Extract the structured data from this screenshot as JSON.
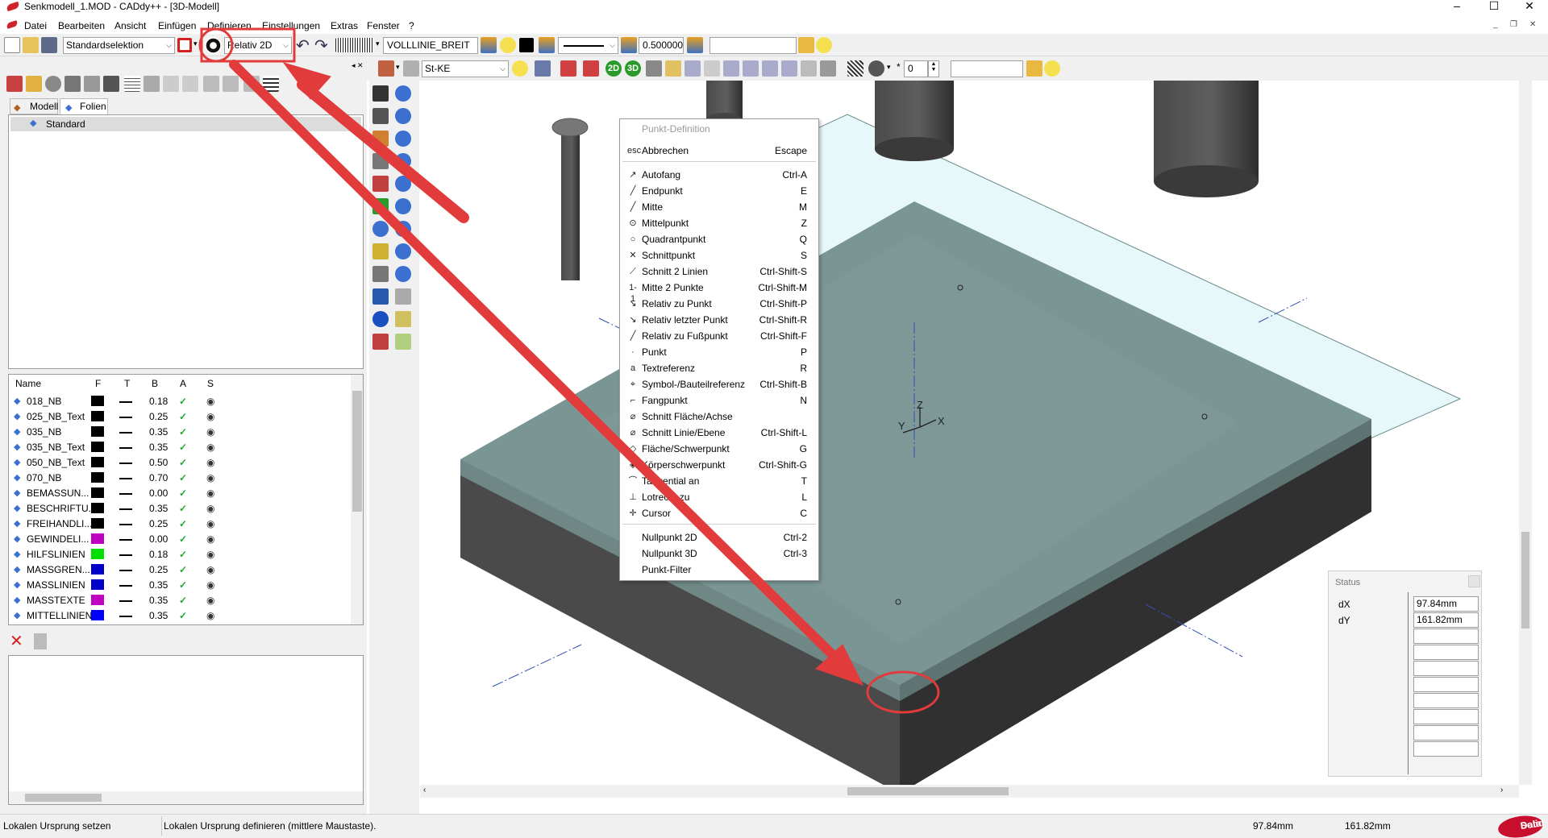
{
  "window": {
    "title": "Senkmodell_1.MOD  -  CADdy++ - [3D-Modell]",
    "controls": [
      "–",
      "☐",
      "✕"
    ]
  },
  "menubar": {
    "items": [
      "Datei",
      "Bearbeiten",
      "Ansicht",
      "Einfügen",
      "Definieren",
      "Einstellungen",
      "Extras",
      "Fenster",
      "?"
    ],
    "mdi": [
      "_",
      "❐",
      "✕"
    ]
  },
  "toolbar1": {
    "selection_mode": "Standardselektion",
    "point_mode": "Relativ 2D",
    "linetype_name": "VOLLLINIE_BREIT",
    "line_width": "0.500000",
    "empty_field": ""
  },
  "toolbar2": {
    "material": "St-KE",
    "btn_2d": "2D",
    "btn_3d": "3D",
    "spin_value": "0",
    "empty_field": ""
  },
  "left_panel": {
    "tabs": {
      "model": "Modell",
      "layers": "Folien"
    },
    "tree": {
      "root": "Standard"
    },
    "table": {
      "headers": {
        "name": "Name",
        "f": "F",
        "t": "T",
        "b": "B",
        "a": "A",
        "s": "S"
      },
      "rows": [
        {
          "name": "018_NB",
          "color": "#000000",
          "width": "0.18"
        },
        {
          "name": "025_NB_Text",
          "color": "#000000",
          "width": "0.25"
        },
        {
          "name": "035_NB",
          "color": "#000000",
          "width": "0.35"
        },
        {
          "name": "035_NB_Text",
          "color": "#000000",
          "width": "0.35"
        },
        {
          "name": "050_NB_Text",
          "color": "#000000",
          "width": "0.50"
        },
        {
          "name": "070_NB",
          "color": "#000000",
          "width": "0.70"
        },
        {
          "name": "BEMASSUN...",
          "color": "#000000",
          "width": "0.00"
        },
        {
          "name": "BESCHRIFTU...",
          "color": "#000000",
          "width": "0.35"
        },
        {
          "name": "FREIHANDLI...",
          "color": "#000000",
          "width": "0.25"
        },
        {
          "name": "GEWINDELI...",
          "color": "#c000c0",
          "width": "0.00"
        },
        {
          "name": "HILFSLINIEN",
          "color": "#00e000",
          "width": "0.18"
        },
        {
          "name": "MASSGREN...",
          "color": "#0000c8",
          "width": "0.25"
        },
        {
          "name": "MASSLINIEN",
          "color": "#0000c8",
          "width": "0.35"
        },
        {
          "name": "MASSTEXTE",
          "color": "#c000c0",
          "width": "0.35"
        },
        {
          "name": "MITTELLINIEN",
          "color": "#0000ff",
          "width": "0.35"
        }
      ]
    }
  },
  "context_menu": {
    "header": "Punkt-Definition",
    "items": [
      {
        "label": "Abbrechen",
        "shortcut": "Escape",
        "icon": "esc-icon",
        "glyph": "esc"
      },
      {
        "label": "Autofang",
        "shortcut": "Ctrl-A",
        "icon": "autofang-icon",
        "glyph": "↗"
      },
      {
        "label": "Endpunkt",
        "shortcut": "E",
        "icon": "endpoint-icon",
        "glyph": "╱"
      },
      {
        "label": "Mitte",
        "shortcut": "M",
        "icon": "midpoint-icon",
        "glyph": "╱"
      },
      {
        "label": "Mittelpunkt",
        "shortcut": "Z",
        "icon": "center-icon",
        "glyph": "⊙"
      },
      {
        "label": "Quadrantpunkt",
        "shortcut": "Q",
        "icon": "quadrant-icon",
        "glyph": "○"
      },
      {
        "label": "Schnittpunkt",
        "shortcut": "S",
        "icon": "intersection-icon",
        "glyph": "✕"
      },
      {
        "label": "Schnitt 2 Linien",
        "shortcut": "Ctrl-Shift-S",
        "icon": "intersect-lines-icon",
        "glyph": "⟋"
      },
      {
        "label": "Mitte 2 Punkte",
        "shortcut": "Ctrl-Shift-M",
        "icon": "mid-two-points-icon",
        "glyph": "1-1"
      },
      {
        "label": "Relativ zu Punkt",
        "shortcut": "Ctrl-Shift-P",
        "icon": "relative-point-icon",
        "glyph": "↘"
      },
      {
        "label": "Relativ letzter Punkt",
        "shortcut": "Ctrl-Shift-R",
        "icon": "relative-last-point-icon",
        "glyph": "↘"
      },
      {
        "label": "Relativ zu Fußpunkt",
        "shortcut": "Ctrl-Shift-F",
        "icon": "relative-foot-icon",
        "glyph": "╱"
      },
      {
        "label": "Punkt",
        "shortcut": "P",
        "icon": "point-icon",
        "glyph": "·"
      },
      {
        "label": "Textreferenz",
        "shortcut": "R",
        "icon": "text-reference-icon",
        "glyph": "a"
      },
      {
        "label": "Symbol-/Bauteilreferenz",
        "shortcut": "Ctrl-Shift-B",
        "icon": "symbol-reference-icon",
        "glyph": "⌖"
      },
      {
        "label": "Fangpunkt",
        "shortcut": "N",
        "icon": "snap-point-icon",
        "glyph": "⌐"
      },
      {
        "label": "Schnitt Fläche/Achse",
        "shortcut": "",
        "icon": "face-axis-icon",
        "glyph": "⌀"
      },
      {
        "label": "Schnitt Linie/Ebene",
        "shortcut": "Ctrl-Shift-L",
        "icon": "line-plane-icon",
        "glyph": "⌀"
      },
      {
        "label": "Fläche/Schwerpunkt",
        "shortcut": "G",
        "icon": "face-centroid-icon",
        "glyph": "◇"
      },
      {
        "label": "Körperschwerpunkt",
        "shortcut": "Ctrl-Shift-G",
        "icon": "body-centroid-icon",
        "glyph": "◈"
      },
      {
        "label": "Tangential an",
        "shortcut": "T",
        "icon": "tangent-icon",
        "glyph": "⌒"
      },
      {
        "label": "Lotrecht zu",
        "shortcut": "L",
        "icon": "perpendicular-icon",
        "glyph": "⊥"
      },
      {
        "label": "Cursor",
        "shortcut": "C",
        "icon": "cursor-icon",
        "glyph": "✛"
      },
      {
        "label": "Nullpunkt 2D",
        "shortcut": "Ctrl-2",
        "icon": "",
        "glyph": ""
      },
      {
        "label": "Nullpunkt 3D",
        "shortcut": "Ctrl-3",
        "icon": "",
        "glyph": ""
      },
      {
        "label": "Punkt-Filter",
        "shortcut": "",
        "icon": "",
        "glyph": ""
      }
    ]
  },
  "viewport": {
    "axis_labels": {
      "y": "Y",
      "z": "Z",
      "x": "X"
    }
  },
  "status_panel": {
    "title": "Status",
    "rows": [
      {
        "label": "dX",
        "value": "97.84mm"
      },
      {
        "label": "dY",
        "value": "161.82mm"
      }
    ]
  },
  "statusbar": {
    "left": "Lokalen Ursprung setzen",
    "message": "Lokalen Ursprung definieren (mittlere Maustaste).",
    "dx": "97.84mm",
    "dy": "161.82mm",
    "logo_top": "Data",
    "logo_bottom": "Solid"
  },
  "colors": {
    "annotation_red": "#e23b3b",
    "slab_top": "#7a9694",
    "slab_side_dark": "#3a3a3a",
    "glass": "#e6f8fa",
    "ui_bg": "#f0f0f0"
  }
}
